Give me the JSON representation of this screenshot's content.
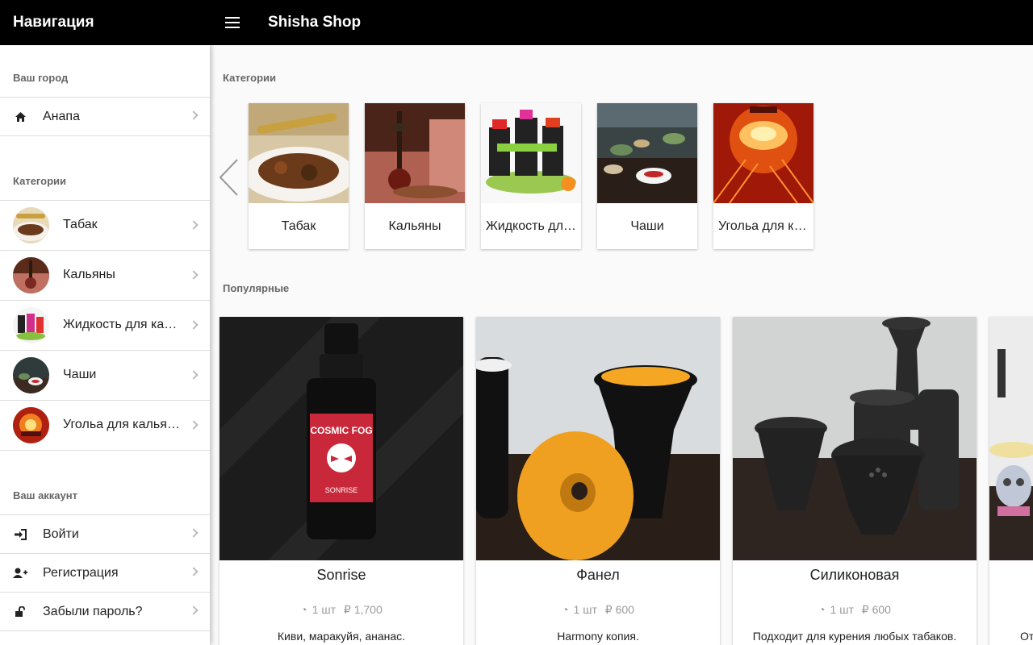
{
  "header": {
    "nav_title": "Навигация",
    "shop_title": "Shisha Shop"
  },
  "sidebar": {
    "city_section": "Ваш город",
    "city": {
      "label": "Анапа",
      "icon": "home-icon"
    },
    "categories_section": "Категории",
    "categories": [
      {
        "label": "Табак"
      },
      {
        "label": "Кальяны"
      },
      {
        "label": "Жидкость для кальяна"
      },
      {
        "label": "Чаши"
      },
      {
        "label": "Угольа для кальяна"
      }
    ],
    "account_section": "Ваш аккаунт",
    "account_items": [
      {
        "label": "Войти",
        "icon": "sign-in-icon"
      },
      {
        "label": "Регистрация",
        "icon": "user-plus-icon"
      },
      {
        "label": "Забыли пароль?",
        "icon": "unlock-icon"
      }
    ]
  },
  "main": {
    "categories_section": "Категории",
    "category_cards": [
      {
        "label": "Табак"
      },
      {
        "label": "Кальяны"
      },
      {
        "label": "Жидкость для кальяна"
      },
      {
        "label": "Чаши"
      },
      {
        "label": "Угольа для кальяна"
      }
    ],
    "popular_section": "Популярные",
    "products": [
      {
        "name": "Sonrise",
        "qty": "1 шт",
        "price": "₽ 1,700",
        "desc": "Киви, маракуйя, ананас."
      },
      {
        "name": "Фанел",
        "qty": "1 шт",
        "price": "₽ 600",
        "desc": "Harmony копия."
      },
      {
        "name": "Силиконовая",
        "qty": "1 шт",
        "price": "₽ 600",
        "desc": "Подходит для курения любых табаков."
      },
      {
        "name": "",
        "qty": "",
        "price": "",
        "desc": "От"
      }
    ]
  },
  "colors": {
    "header_bg": "#000000",
    "accent_orange": "#f5a623",
    "card_bg": "#ffffff"
  }
}
